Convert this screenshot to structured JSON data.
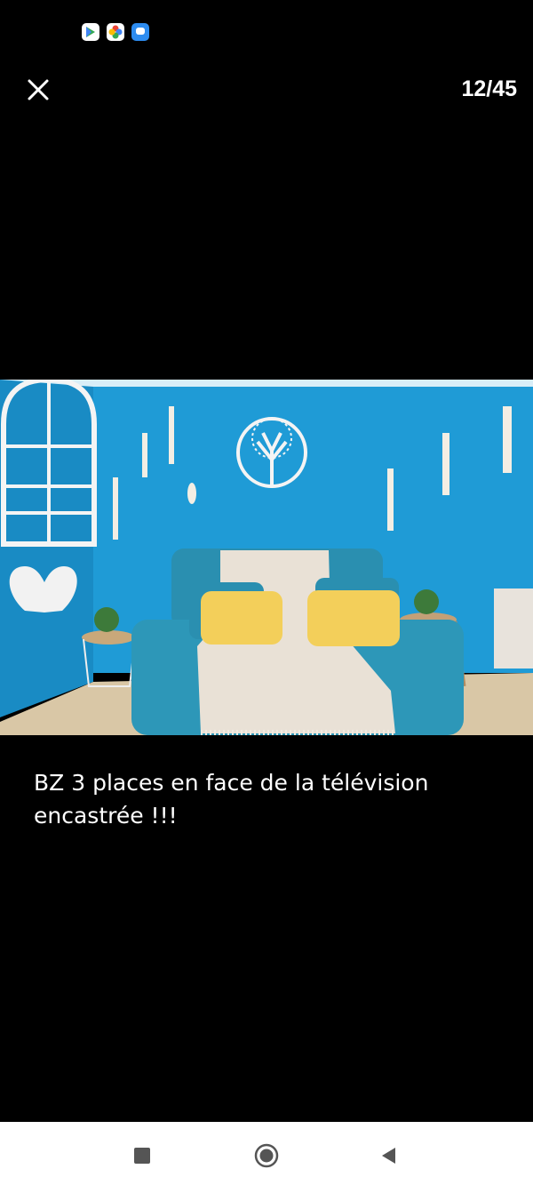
{
  "status_bar": {
    "icons": [
      "play-store-icon",
      "google-photos-icon",
      "messages-icon"
    ]
  },
  "viewer": {
    "close_icon": "close-icon",
    "counter": "12/45"
  },
  "photo": {
    "description_icon": "listing-photo",
    "colors": {
      "wall": "#1f9bd6",
      "sofa": "#2a8fb0",
      "throw": "#e9e1d6",
      "cushion": "#f3cf5a",
      "floor": "#d9c7a6"
    }
  },
  "caption": {
    "text": "BZ 3 places en face de la télévision encastrée !!!"
  },
  "nav_bar": {
    "recents_icon": "recents-square-icon",
    "home_icon": "home-circle-icon",
    "back_icon": "back-triangle-icon"
  }
}
